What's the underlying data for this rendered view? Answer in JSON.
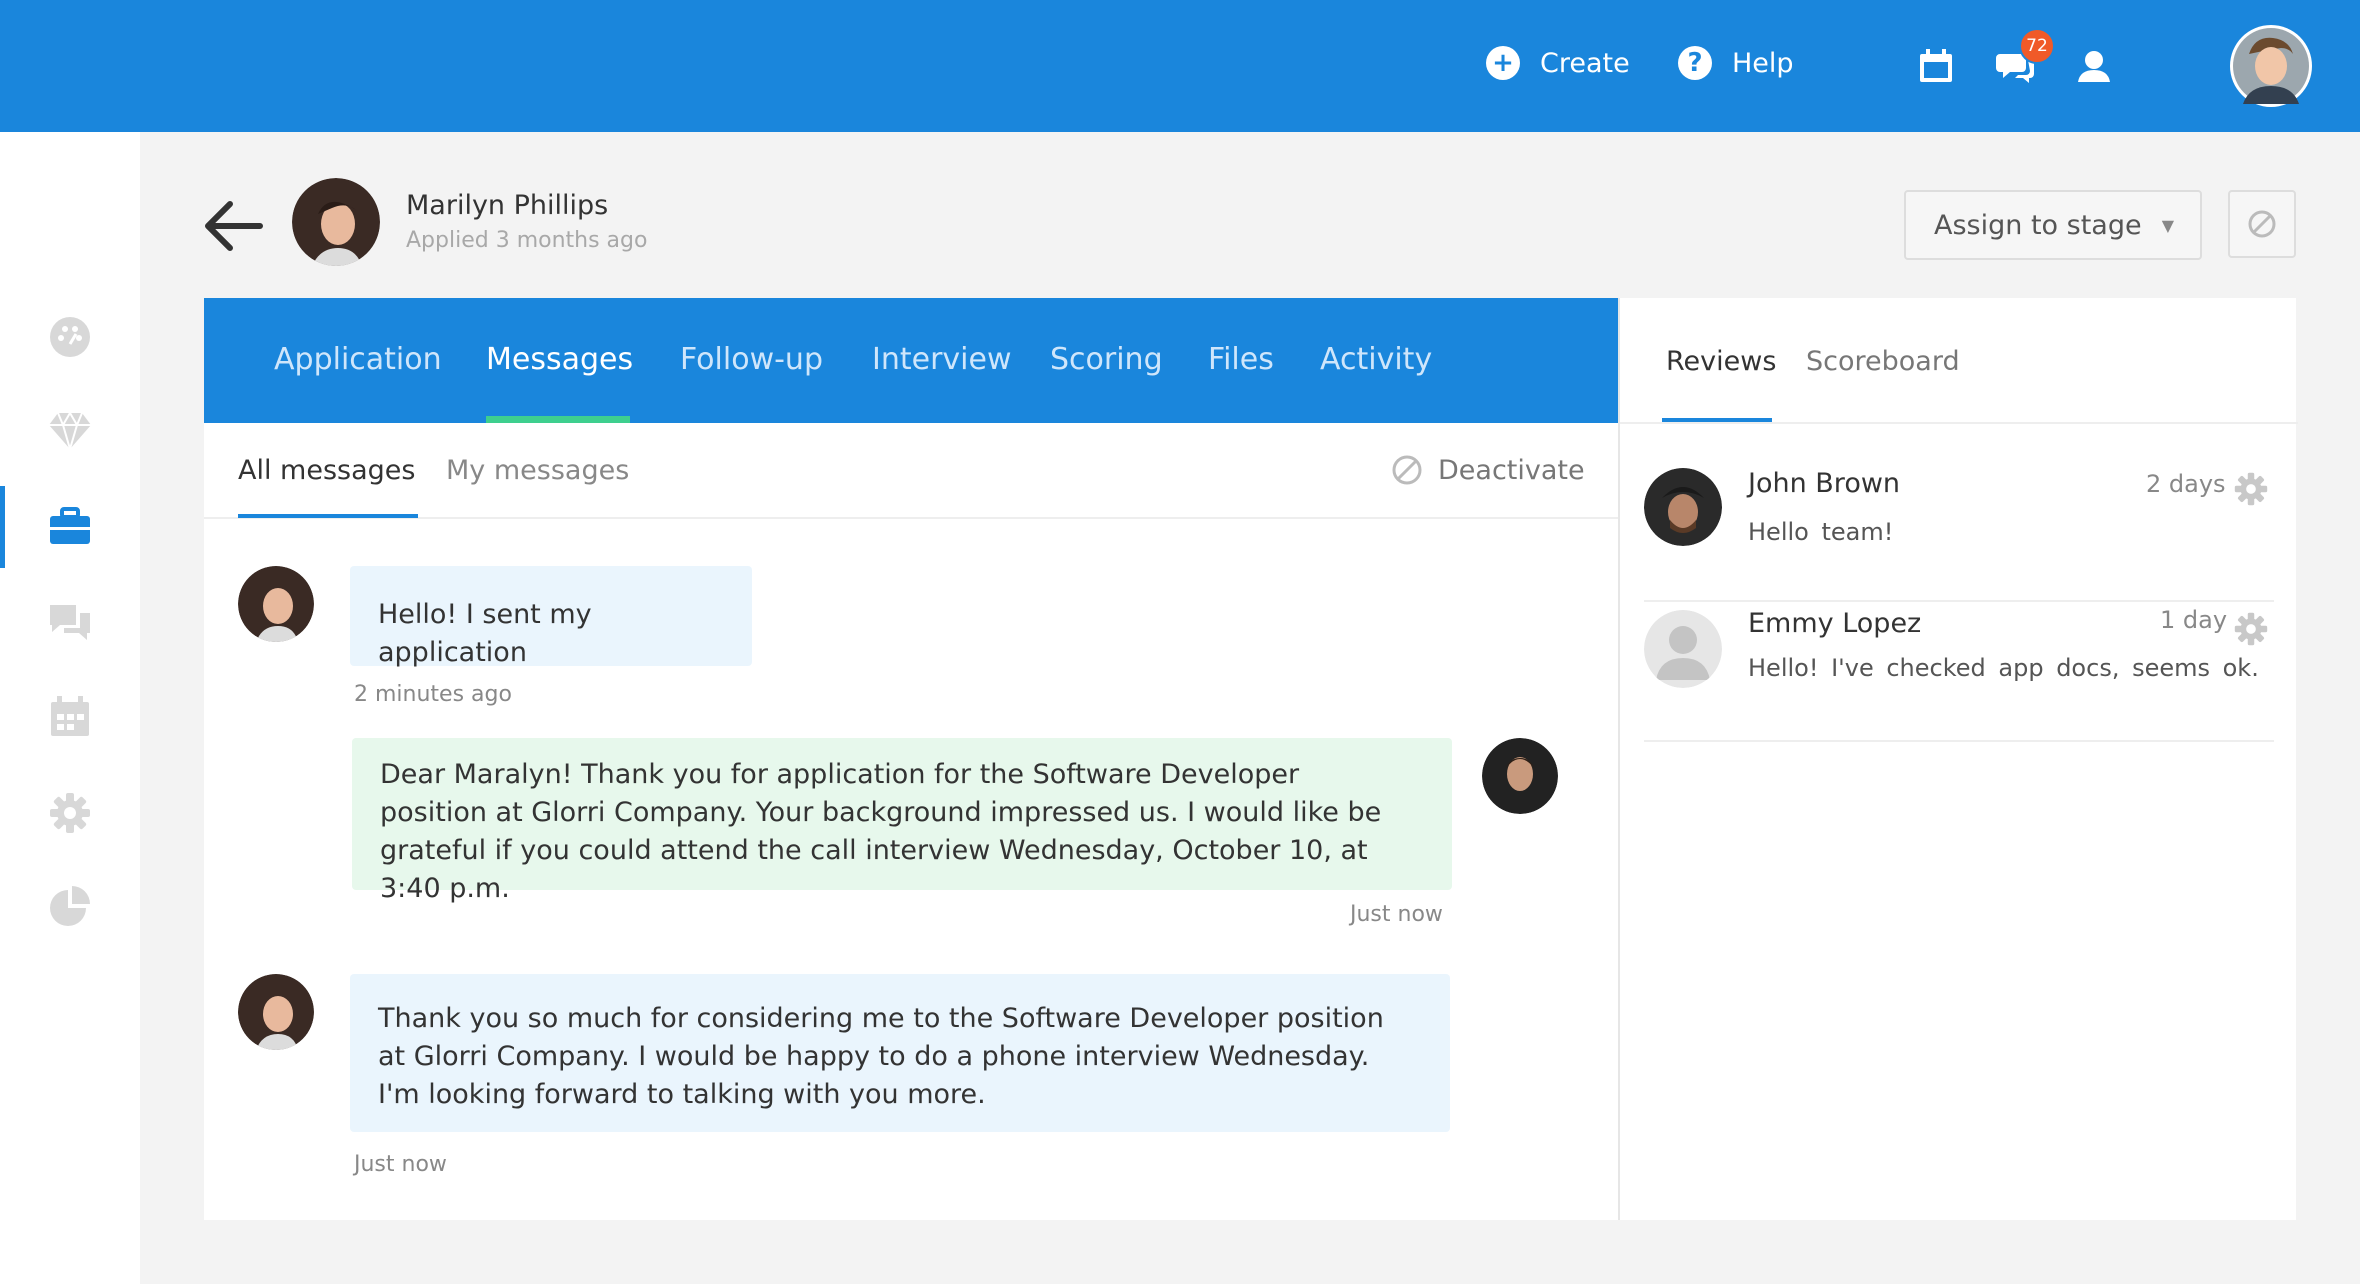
{
  "topbar": {
    "create_label": "Create",
    "help_label": "Help",
    "notification_count": "72",
    "brand_color": "#1a86dc"
  },
  "sidebar": {
    "items": [
      {
        "icon": "dashboard-icon"
      },
      {
        "icon": "diamond-icon"
      },
      {
        "icon": "briefcase-icon",
        "active": true
      },
      {
        "icon": "chat-icon"
      },
      {
        "icon": "calendar-icon"
      },
      {
        "icon": "gear-icon"
      },
      {
        "icon": "pie-chart-icon"
      }
    ]
  },
  "candidate": {
    "name": "Marilyn Phillips",
    "applied": "Applied 3 months ago"
  },
  "header": {
    "assign_label": "Assign to stage"
  },
  "tabs": [
    "Application",
    "Messages",
    "Follow-up",
    "Interview",
    "Scoring",
    "Files",
    "Activity"
  ],
  "active_tab": "Messages",
  "subtabs": {
    "all": "All messages",
    "mine": "My messages",
    "deactivate": "Deactivate"
  },
  "messages": [
    {
      "from": "candidate",
      "lines": [
        "Hello! I sent my application"
      ],
      "time": "2 minutes ago"
    },
    {
      "from": "recruiter",
      "lines": [
        "Dear Maralyn! Thank you for application for the Software Developer",
        "position at Glorri Company. Your background impressed us. I would like be",
        "grateful if you could attend the call interview Wednesday, October 10, at 3:40 p.m."
      ],
      "time": "Just now"
    },
    {
      "from": "candidate",
      "lines": [
        "Thank you so much for considering me to the Software Developer position",
        "at Glorri Company. I would be happy to do a phone interview Wednesday.",
        "I'm looking forward to talking with you more."
      ],
      "time": "Just now"
    }
  ],
  "review_tabs": {
    "reviews": "Reviews",
    "scoreboard": "Scoreboard"
  },
  "reviews": [
    {
      "name": "John Brown",
      "time": "2 days",
      "text": "Hello team!"
    },
    {
      "name": "Emmy Lopez",
      "time": "1 day",
      "text": "Hello! I've checked app docs, seems ok."
    }
  ]
}
